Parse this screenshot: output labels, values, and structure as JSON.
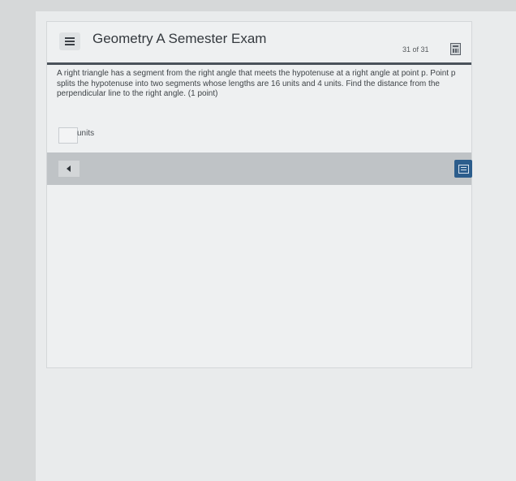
{
  "header": {
    "title": "Geometry A Semester Exam",
    "counter": "31 of 31"
  },
  "question": {
    "text": "A right triangle has a segment from the right angle that meets the hypotenuse at a right angle at point p. Point p splits the hypotenuse into two segments whose lengths are 16 units and 4 units. Find the distance from the perpendicular line to the right angle. (1 point)"
  },
  "answer": {
    "value": "",
    "units_label": "units"
  },
  "icons": {
    "menu": "hamburger-icon",
    "calculator": "calculator-icon",
    "back": "back-arrow-icon",
    "review": "review-list-icon"
  },
  "colors": {
    "review_button": "#2c5d8c",
    "header_rule": "#4a525a",
    "footer_bar": "#bfc3c6"
  }
}
